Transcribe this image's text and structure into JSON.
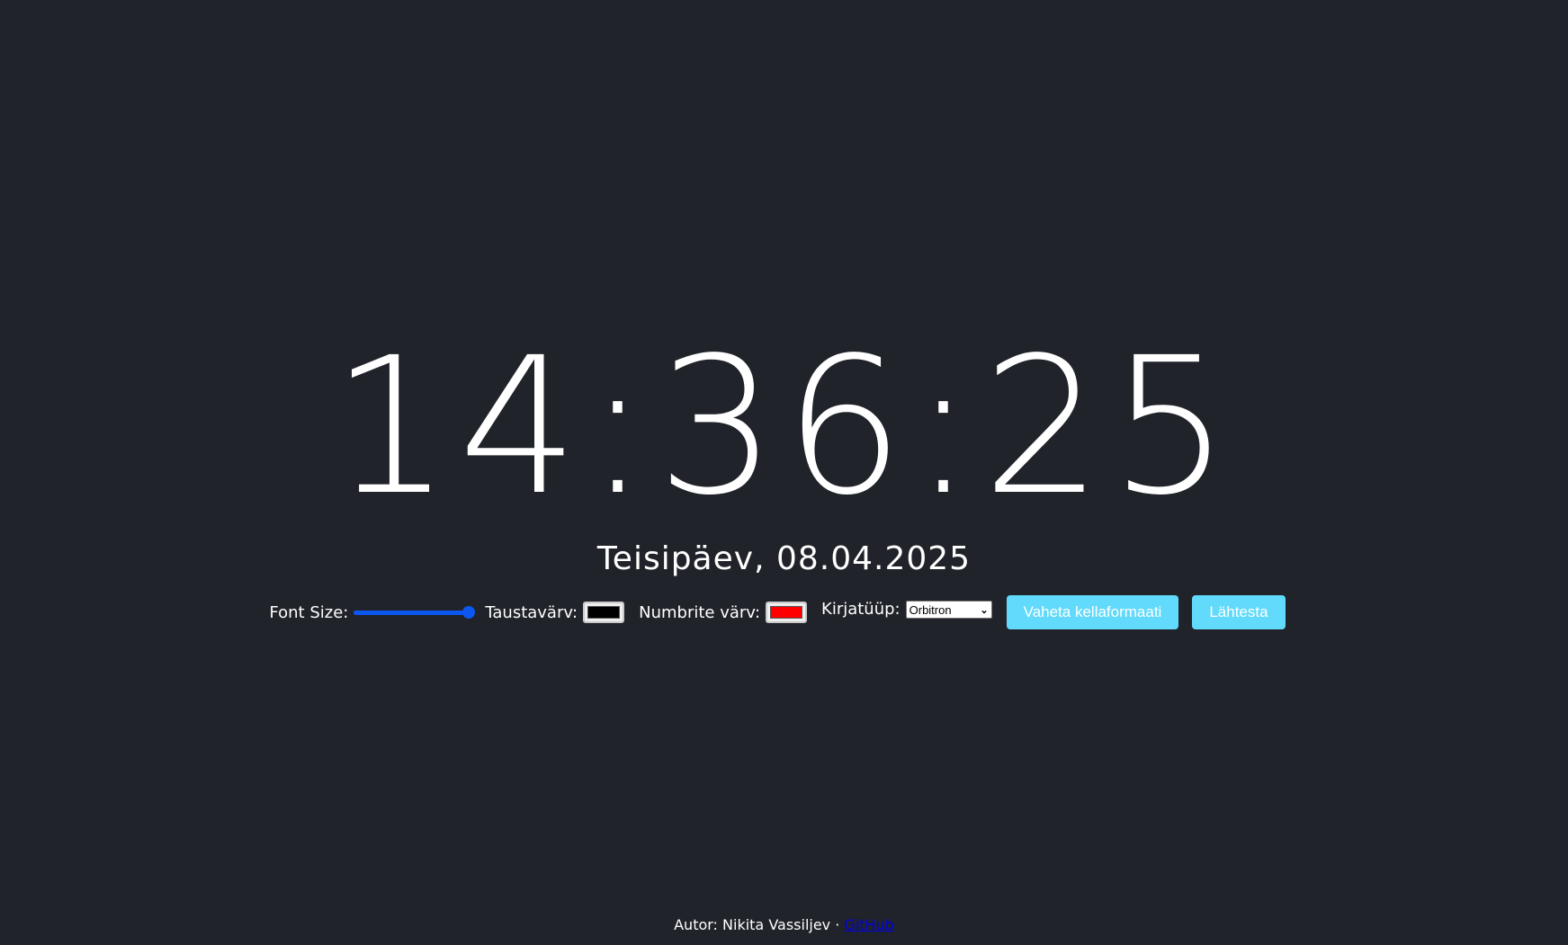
{
  "clock": {
    "time": "14:36:25",
    "date": "Teisipäev, 08.04.2025"
  },
  "controls": {
    "font_size_label": "Font Size:",
    "font_size_value": 1.0,
    "background_color_label": "Taustavärv:",
    "background_color_value": "#000000",
    "number_color_label": "Numbrite värv:",
    "number_color_value": "#ff0000",
    "font_label": "Kirjatüüp:",
    "font_selected": "Orbitron",
    "toggle_format_label": "Vaheta kellaformaati",
    "reset_label": "Lähtesta"
  },
  "footer": {
    "author_text": "Autor: Nikita Vassiljev ·",
    "github_link": "GitHub"
  },
  "colors": {
    "background": "#20232a",
    "text": "#ffffff",
    "accent": "#61dafb",
    "slider": "#0b57f0",
    "link": "#0000ee"
  }
}
